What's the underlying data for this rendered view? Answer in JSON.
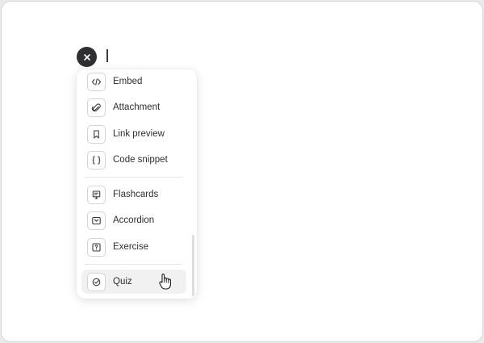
{
  "menu": {
    "groups": [
      {
        "items": [
          {
            "label": "Embed",
            "icon": "embed-code-icon"
          },
          {
            "label": "Attachment",
            "icon": "paperclip-icon"
          },
          {
            "label": "Link preview",
            "icon": "bookmark-icon"
          },
          {
            "label": "Code snippet",
            "icon": "curly-braces-icon"
          }
        ]
      },
      {
        "items": [
          {
            "label": "Flashcards",
            "icon": "flashcards-icon"
          },
          {
            "label": "Accordion",
            "icon": "accordion-icon"
          },
          {
            "label": "Exercise",
            "icon": "question-mark-icon"
          }
        ]
      },
      {
        "items": [
          {
            "label": "Quiz",
            "icon": "check-circle-icon",
            "hovered": true
          }
        ]
      }
    ]
  },
  "colors": {
    "close_button_bg": "#2f2f31",
    "hover_bg": "#f1f1f1",
    "icon_stroke": "#3a3a3a"
  }
}
